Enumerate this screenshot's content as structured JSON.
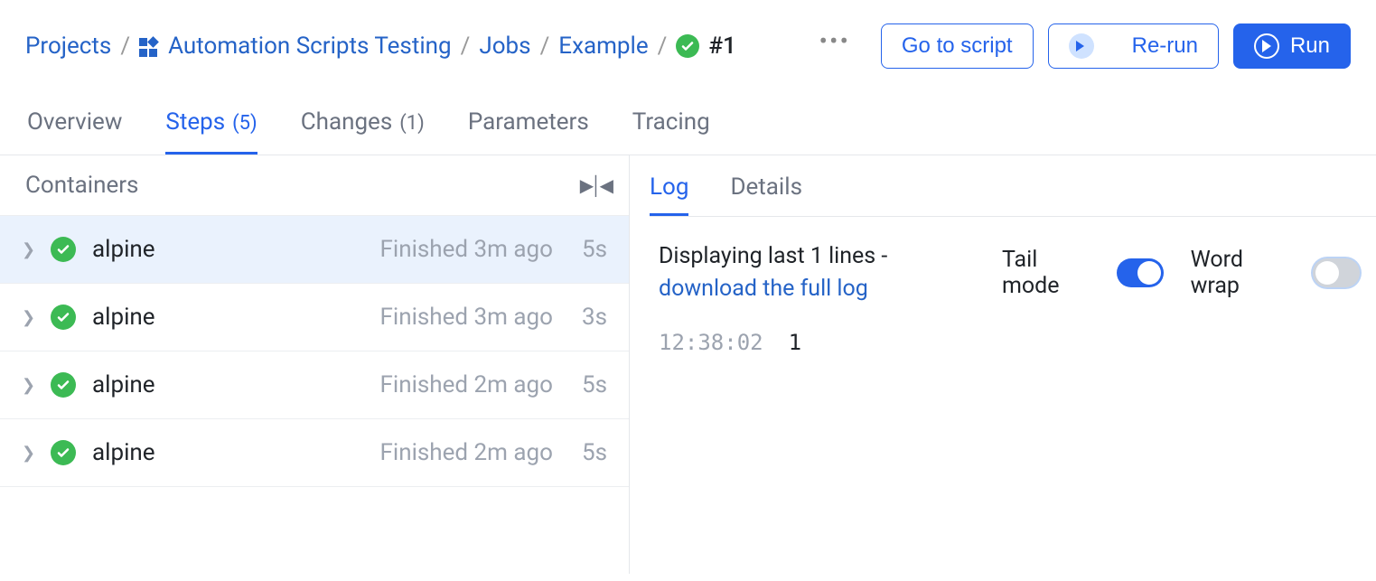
{
  "breadcrumb": {
    "projects": "Projects",
    "project": "Automation Scripts Testing",
    "jobs": "Jobs",
    "job": "Example",
    "run": "#1"
  },
  "header_buttons": {
    "go_to_script": "Go to script",
    "rerun": "Re-run",
    "run": "Run"
  },
  "tabs": {
    "overview": "Overview",
    "steps_label": "Steps",
    "steps_count": "(5)",
    "changes_label": "Changes",
    "changes_count": "(1)",
    "parameters": "Parameters",
    "tracing": "Tracing"
  },
  "left": {
    "title": "Containers",
    "rows": [
      {
        "name": "alpine",
        "finished": "Finished 3m ago",
        "duration": "5s"
      },
      {
        "name": "alpine",
        "finished": "Finished 3m ago",
        "duration": "3s"
      },
      {
        "name": "alpine",
        "finished": "Finished 2m ago",
        "duration": "5s"
      },
      {
        "name": "alpine",
        "finished": "Finished 2m ago",
        "duration": "5s"
      }
    ]
  },
  "right": {
    "subtabs": {
      "log": "Log",
      "details": "Details"
    },
    "display_text": "Displaying last 1 lines - ",
    "download_link": "download the full log",
    "tail_label": "Tail mode",
    "wrap_label": "Word wrap",
    "log": {
      "timestamp": "12:38:02",
      "message": "1"
    }
  }
}
